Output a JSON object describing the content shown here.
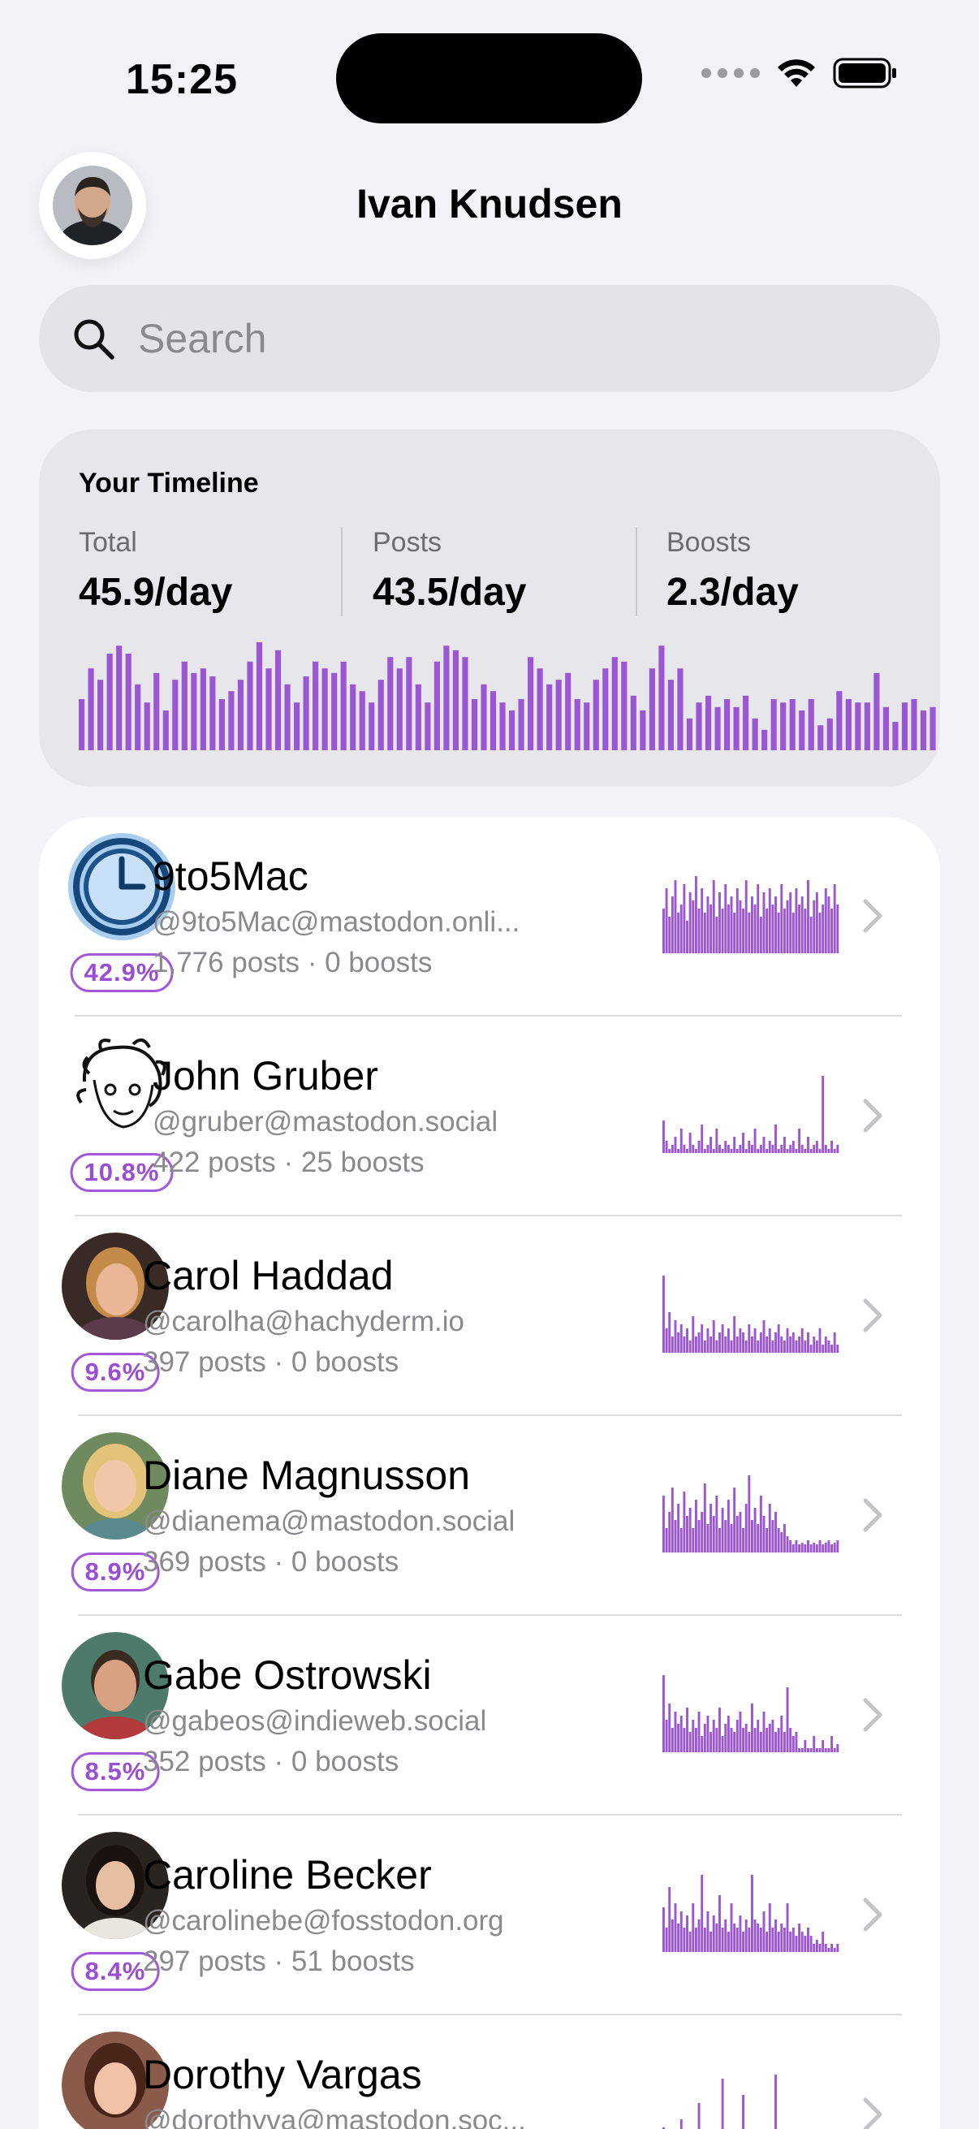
{
  "status_bar": {
    "time": "15:25",
    "icons": [
      "signal-dots-icon",
      "wifi-icon",
      "battery-icon"
    ]
  },
  "header": {
    "title": "Ivan Knudsen",
    "avatar_icon": "profile-avatar"
  },
  "search": {
    "placeholder": "Search",
    "value": ""
  },
  "timeline": {
    "title": "Your Timeline",
    "stats": [
      {
        "label": "Total",
        "value": "45.9/day"
      },
      {
        "label": "Posts",
        "value": "43.5/day"
      },
      {
        "label": "Boosts",
        "value": "2.3/day"
      }
    ],
    "bars": [
      0.45,
      0.72,
      0.62,
      0.85,
      0.92,
      0.85,
      0.58,
      0.42,
      0.68,
      0.35,
      0.62,
      0.78,
      0.68,
      0.72,
      0.65,
      0.45,
      0.52,
      0.62,
      0.78,
      0.95,
      0.72,
      0.88,
      0.58,
      0.42,
      0.65,
      0.78,
      0.72,
      0.68,
      0.78,
      0.58,
      0.52,
      0.42,
      0.62,
      0.82,
      0.72,
      0.82,
      0.58,
      0.42,
      0.78,
      0.92,
      0.88,
      0.82,
      0.45,
      0.58,
      0.52,
      0.42,
      0.35,
      0.45,
      0.82,
      0.72,
      0.58,
      0.62,
      0.68,
      0.45,
      0.42,
      0.62,
      0.72,
      0.82,
      0.78,
      0.48,
      0.35,
      0.72,
      0.92,
      0.62,
      0.72,
      0.28,
      0.42,
      0.48,
      0.38,
      0.45,
      0.38,
      0.48,
      0.28,
      0.18,
      0.45,
      0.42,
      0.45,
      0.35,
      0.45,
      0.22,
      0.28,
      0.52,
      0.45,
      0.42,
      0.42,
      0.68,
      0.38,
      0.25,
      0.42,
      0.45,
      0.35,
      0.38
    ],
    "accent": "#9b57d3"
  },
  "rows": [
    {
      "name": "9to5Mac",
      "handle": "@9to5Mac@mastodon.onli...",
      "counts": "1,776 posts · 0 boosts",
      "percent": "42.9%",
      "avatar": "clock-icon",
      "bars": [
        0.55,
        0.8,
        0.45,
        0.7,
        0.9,
        0.5,
        0.6,
        0.85,
        0.4,
        0.75,
        0.65,
        0.95,
        0.55,
        0.8,
        0.5,
        0.7,
        0.6,
        0.9,
        0.45,
        0.75,
        0.55,
        0.85,
        0.6,
        0.7,
        0.5,
        0.8,
        0.65,
        0.55,
        0.9,
        0.5,
        0.7,
        0.6,
        0.85,
        0.45,
        0.75,
        0.55,
        0.8,
        0.6,
        0.7,
        0.5,
        0.85,
        0.55,
        0.65,
        0.75,
        0.5,
        0.8,
        0.6,
        0.7,
        0.55,
        0.9,
        0.45,
        0.65,
        0.75,
        0.5,
        0.6,
        0.8,
        0.7,
        0.55,
        0.85,
        0.6
      ]
    },
    {
      "name": "John Gruber",
      "handle": "@gruber@mastodon.social",
      "counts": "422 posts · 25 boosts",
      "percent": "10.8%",
      "avatar": "sketch-avatar",
      "bars": [
        0.4,
        0.15,
        0.05,
        0.1,
        0.2,
        0.05,
        0.3,
        0.1,
        0.05,
        0.25,
        0.1,
        0.05,
        0.15,
        0.35,
        0.05,
        0.1,
        0.2,
        0.05,
        0.3,
        0.1,
        0.05,
        0.15,
        0.1,
        0.05,
        0.2,
        0.05,
        0.1,
        0.25,
        0.05,
        0.15,
        0.1,
        0.3,
        0.05,
        0.1,
        0.2,
        0.05,
        0.15,
        0.1,
        0.35,
        0.05,
        0.1,
        0.2,
        0.05,
        0.1,
        0.15,
        0.05,
        0.3,
        0.1,
        0.05,
        0.2,
        0.05,
        0.1,
        0.15,
        0.05,
        0.95,
        0.1,
        0.05,
        0.15,
        0.05,
        0.1
      ]
    },
    {
      "name": "Carol Haddad",
      "handle": "@carolha@hachyderm.io",
      "counts": "397 posts · 0 boosts",
      "percent": "9.6%",
      "avatar": "carol-avatar",
      "bars": [
        0.95,
        0.3,
        0.5,
        0.2,
        0.4,
        0.25,
        0.35,
        0.2,
        0.3,
        0.15,
        0.45,
        0.2,
        0.25,
        0.35,
        0.15,
        0.3,
        0.2,
        0.4,
        0.15,
        0.25,
        0.35,
        0.2,
        0.3,
        0.15,
        0.45,
        0.2,
        0.3,
        0.25,
        0.15,
        0.35,
        0.2,
        0.3,
        0.15,
        0.25,
        0.4,
        0.2,
        0.3,
        0.15,
        0.25,
        0.35,
        0.2,
        0.15,
        0.3,
        0.2,
        0.25,
        0.15,
        0.2,
        0.3,
        0.15,
        0.25,
        0.1,
        0.2,
        0.15,
        0.3,
        0.1,
        0.2,
        0.15,
        0.1,
        0.25,
        0.1
      ]
    },
    {
      "name": "Diane Magnusson",
      "handle": "@dianema@mastodon.social",
      "counts": "369 posts · 0 boosts",
      "percent": "8.9%",
      "avatar": "diane-avatar",
      "bars": [
        0.7,
        0.3,
        0.5,
        0.8,
        0.4,
        0.6,
        0.3,
        0.75,
        0.45,
        0.55,
        0.3,
        0.65,
        0.4,
        0.5,
        0.85,
        0.35,
        0.6,
        0.45,
        0.7,
        0.3,
        0.55,
        0.4,
        0.65,
        0.35,
        0.8,
        0.45,
        0.5,
        0.3,
        0.6,
        0.95,
        0.4,
        0.55,
        0.35,
        0.7,
        0.45,
        0.3,
        0.6,
        0.4,
        0.5,
        0.3,
        0.25,
        0.35,
        0.2,
        0.15,
        0.1,
        0.15,
        0.1,
        0.12,
        0.1,
        0.15,
        0.1,
        0.12,
        0.1,
        0.15,
        0.1,
        0.12,
        0.15,
        0.1,
        0.12,
        0.15
      ]
    },
    {
      "name": "Gabe Ostrowski",
      "handle": "@gabeos@indieweb.social",
      "counts": "352 posts · 0 boosts",
      "percent": "8.5%",
      "avatar": "gabe-avatar",
      "bars": [
        0.95,
        0.4,
        0.6,
        0.3,
        0.5,
        0.35,
        0.45,
        0.3,
        0.55,
        0.25,
        0.4,
        0.3,
        0.5,
        0.2,
        0.35,
        0.45,
        0.25,
        0.4,
        0.3,
        0.55,
        0.2,
        0.35,
        0.45,
        0.3,
        0.25,
        0.4,
        0.5,
        0.3,
        0.35,
        0.25,
        0.6,
        0.3,
        0.4,
        0.25,
        0.5,
        0.3,
        0.35,
        0.4,
        0.25,
        0.3,
        0.45,
        0.25,
        0.8,
        0.3,
        0.2,
        0.25,
        0.05,
        0.05,
        0.15,
        0.05,
        0.05,
        0.2,
        0.05,
        0.05,
        0.15,
        0.05,
        0.05,
        0.2,
        0.05,
        0.1
      ]
    },
    {
      "name": "Caroline Becker",
      "handle": "@carolinebe@fosstodon.org",
      "counts": "297 posts · 51 boosts",
      "percent": "8.4%",
      "avatar": "caroline-avatar",
      "bars": [
        0.55,
        0.3,
        0.8,
        0.4,
        0.6,
        0.35,
        0.5,
        0.3,
        0.45,
        0.25,
        0.6,
        0.3,
        0.4,
        0.95,
        0.3,
        0.5,
        0.25,
        0.45,
        0.35,
        0.7,
        0.3,
        0.4,
        0.25,
        0.6,
        0.35,
        0.3,
        0.45,
        0.25,
        0.4,
        0.3,
        0.95,
        0.4,
        0.35,
        0.3,
        0.5,
        0.25,
        0.6,
        0.3,
        0.4,
        0.25,
        0.35,
        0.3,
        0.6,
        0.25,
        0.3,
        0.2,
        0.35,
        0.25,
        0.2,
        0.3,
        0.2,
        0.1,
        0.15,
        0.1,
        0.25,
        0.1,
        0.05,
        0.1,
        0.05,
        0.1
      ]
    },
    {
      "name": "Dorothy Vargas",
      "handle": "@dorothyva@mastodon.soc...",
      "counts": "",
      "percent": "",
      "avatar": "dorothy-avatar",
      "bars": [
        0.3,
        0.1,
        0.05,
        0.1,
        0.2,
        0.05,
        0.4,
        0.1,
        0.05,
        0.15,
        0.05,
        0.1,
        0.6,
        0.05,
        0.1,
        0.2,
        0.05,
        0.1,
        0.05,
        0.15,
        0.9,
        0.05,
        0.1,
        0.05,
        0.2,
        0.05,
        0.1,
        0.7,
        0.05,
        0.1,
        0.05,
        0.15,
        0.05,
        0.1,
        0.05,
        0.2,
        0.05,
        0.1,
        0.95,
        0.05,
        0.1,
        0.05,
        0.15,
        0.05,
        0.1,
        0.05,
        0.2,
        0.05,
        0.1,
        0.05,
        0.15,
        0.05,
        0.1,
        0.05,
        0.2,
        0.05,
        0.1,
        0.05,
        0.15,
        0.05
      ]
    }
  ]
}
